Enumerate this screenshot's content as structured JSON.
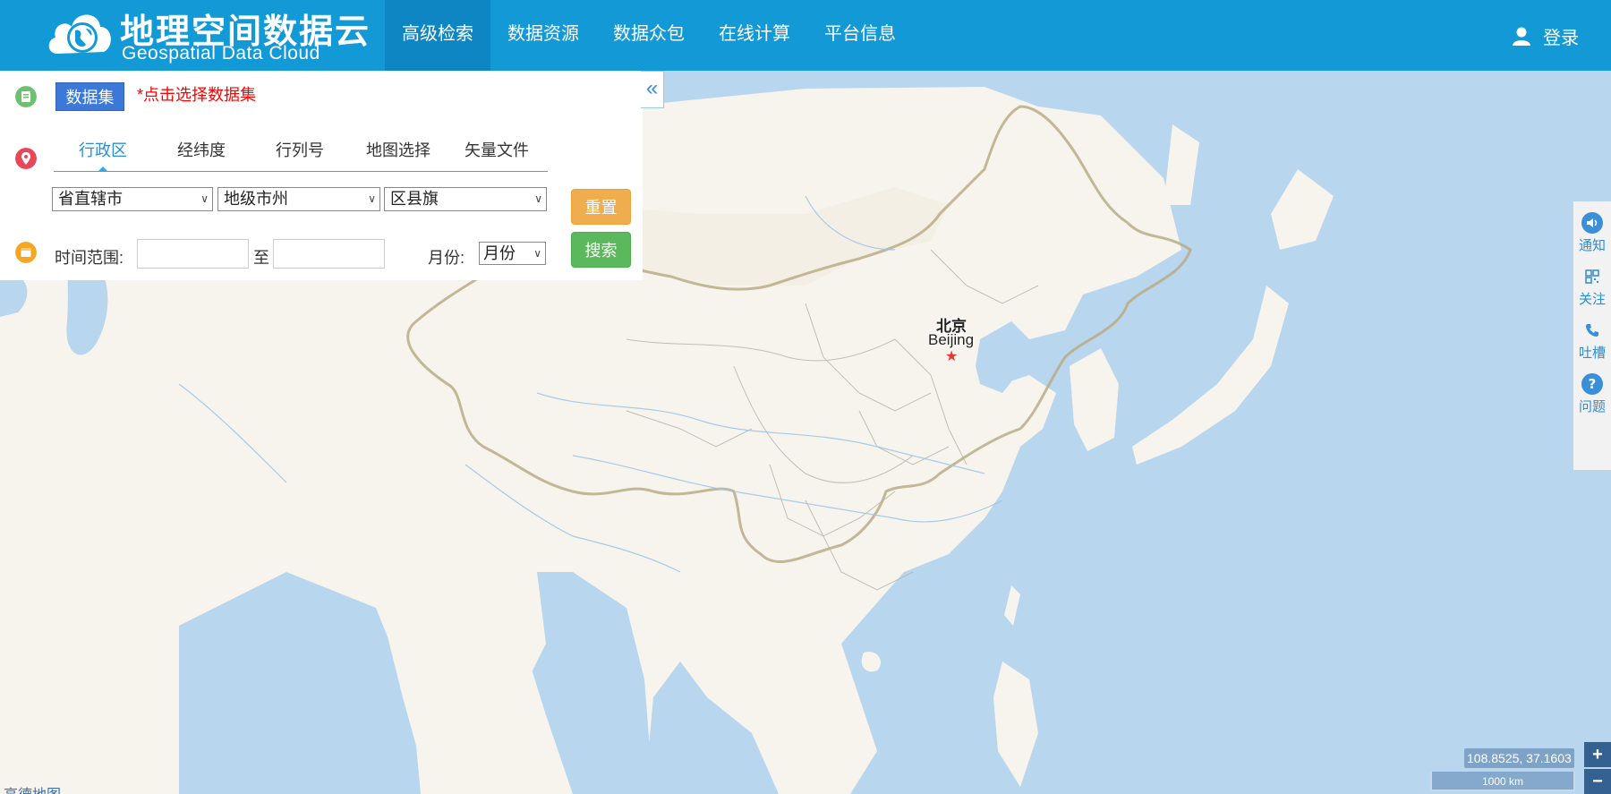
{
  "header": {
    "logo_cn": "地理空间数据云",
    "logo_en": "Geospatial Data Cloud",
    "nav": [
      {
        "label": "高级检索",
        "active": true
      },
      {
        "label": "数据资源",
        "active": false
      },
      {
        "label": "数据众包",
        "active": false
      },
      {
        "label": "在线计算",
        "active": false
      },
      {
        "label": "平台信息",
        "active": false
      }
    ],
    "login_label": "登录"
  },
  "panel": {
    "dataset_button": "数据集",
    "dataset_hint": "*点击选择数据集",
    "tabs": [
      "行政区",
      "经纬度",
      "行列号",
      "地图选择",
      "矢量文件"
    ],
    "active_tab": "行政区",
    "selects": {
      "province": "省直辖市",
      "city": "地级市州",
      "county": "区县旗"
    },
    "reset_button": "重置",
    "search_button": "搜索",
    "time_label": "时间范围:",
    "time_start": "",
    "to_label": "至",
    "time_end": "",
    "month_label": "月份:",
    "month_value": "月份"
  },
  "sidebar": {
    "items": [
      {
        "label": "通知",
        "icon": "speaker-icon"
      },
      {
        "label": "关注",
        "icon": "qrcode-icon"
      },
      {
        "label": "吐槽",
        "icon": "phone-icon"
      },
      {
        "label": "问题",
        "icon": "question-icon"
      }
    ]
  },
  "map": {
    "city_cn": "北京",
    "city_en": "Beijing",
    "coordinates": "108.8525, 37.1603",
    "scale": "1000 km",
    "zoom_in": "+",
    "zoom_out": "−",
    "attribution": "高德地图"
  },
  "colors": {
    "header_bg": "#139ad6",
    "nav_active_bg": "#0e86c4",
    "water": "#b9d6ef",
    "land": "#f7f4ee",
    "reset": "#f0ad4e",
    "search": "#5cb85c",
    "dataset_btn": "#3b78d8",
    "hint_red": "#ff0000"
  }
}
